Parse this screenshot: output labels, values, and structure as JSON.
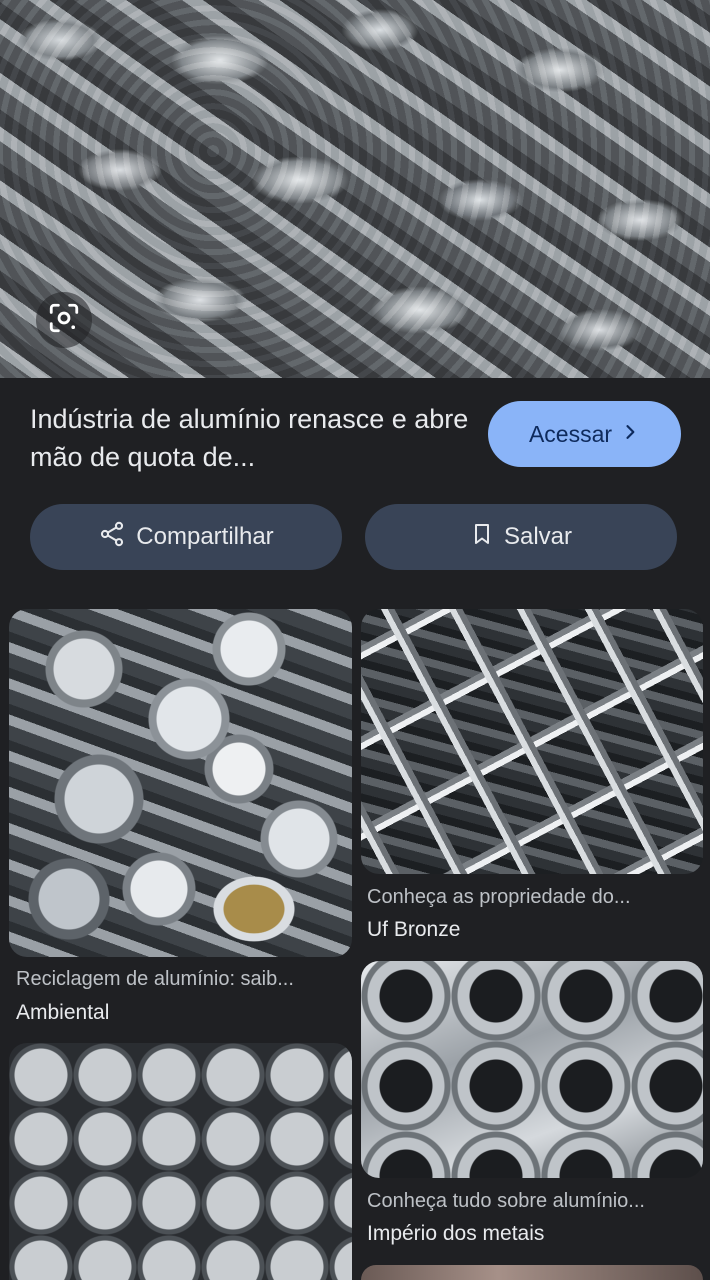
{
  "result": {
    "title": "Indústria de alumínio renasce e abre mão de quota de...",
    "visit_label": "Acessar",
    "share_label": "Compartilhar",
    "save_label": "Salvar"
  },
  "related": [
    {
      "caption": "Reciclagem de alumínio: saib...",
      "source": "Ambiental"
    },
    {
      "caption": "Conheça as propriedade do...",
      "source": "Uf Bronze"
    },
    {
      "caption": "Conheça tudo sobre alumínio...",
      "source": "Império dos metais"
    }
  ],
  "colors": {
    "background": "#1f2023",
    "accent": "#8ab4f8",
    "chip": "#394457"
  },
  "icons": {
    "lens": "google-lens-icon",
    "visit": "chevron-right-icon",
    "share": "share-icon",
    "save": "bookmark-icon"
  }
}
